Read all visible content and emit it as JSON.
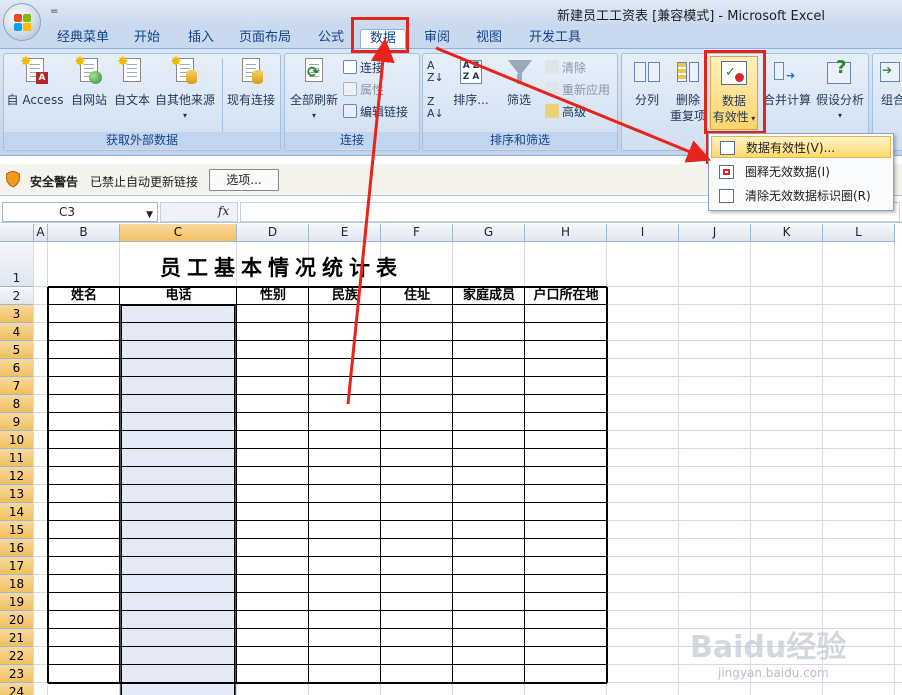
{
  "window": {
    "title": "新建员工工资表  [兼容模式] - Microsoft Excel",
    "qat": "="
  },
  "tabs": [
    "经典菜单",
    "开始",
    "插入",
    "页面布局",
    "公式",
    "数据",
    "审阅",
    "视图",
    "开发工具"
  ],
  "active_tab": "数据",
  "ribbon": {
    "groups": {
      "external": {
        "label": "获取外部数据",
        "buttons": [
          "自 Access",
          "自网站",
          "自文本",
          "自其他来源",
          "现有连接"
        ]
      },
      "connections": {
        "label": "连接",
        "refresh": "全部刷新",
        "items": [
          "连接",
          "属性",
          "编辑链接"
        ]
      },
      "sort_filter": {
        "label": "排序和筛选",
        "sort": "排序...",
        "filter": "筛选",
        "items": [
          "清除",
          "重新应用",
          "高级"
        ]
      },
      "data_tools": {
        "split": "分列",
        "remove_dup_1": "删除",
        "remove_dup_2": "重复项",
        "validation_1": "数据",
        "validation_2": "有效性",
        "consolidate": "合并计算",
        "whatif": "假设分析"
      },
      "outline": {
        "group": "组合"
      }
    }
  },
  "dropdown": {
    "items": [
      "数据有效性(V)...",
      "圈释无效数据(I)",
      "清除无效数据标识圈(R)"
    ]
  },
  "security": {
    "title": "安全警告",
    "text": "已禁止自动更新链接",
    "button": "选项..."
  },
  "formula_bar": {
    "name_box": "C3",
    "fx": "fx",
    "value": ""
  },
  "sheet": {
    "columns": [
      "A",
      "B",
      "C",
      "D",
      "E",
      "F",
      "G",
      "H",
      "I",
      "J",
      "K",
      "L"
    ],
    "selected_column": "C",
    "rows": [
      "1",
      "2",
      "3",
      "4",
      "5",
      "6",
      "7",
      "8",
      "9",
      "10",
      "11",
      "12",
      "13",
      "14",
      "15",
      "16",
      "17",
      "18",
      "19",
      "20",
      "21",
      "22",
      "23",
      "24"
    ],
    "title": "员工基本情况统计表",
    "headers": [
      "姓名",
      "电话",
      "性别",
      "民族",
      "住址",
      "家庭成员",
      "户口所在地"
    ]
  },
  "watermark": {
    "main": "Baidu经验",
    "sub": "jingyan.baidu.com"
  },
  "colors": {
    "highlight_red": "#e8231b",
    "selection_fill": "#e5e9f5",
    "header_select": "#f1c15f"
  }
}
